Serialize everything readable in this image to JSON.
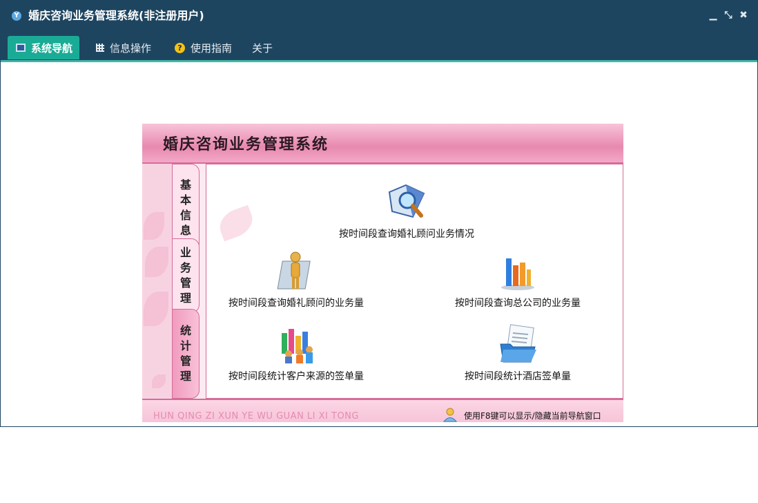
{
  "window": {
    "title": "婚庆咨询业务管理系统(非注册用户)",
    "app_icon": "app-logo-icon",
    "controls": [
      "minimize-icon",
      "restore-icon",
      "close-icon"
    ]
  },
  "menu": {
    "tabs": [
      {
        "label": "系统导航",
        "icon": "monitor-icon",
        "active": true
      },
      {
        "label": "信息操作",
        "icon": "grid-icon",
        "active": false
      },
      {
        "label": "使用指南",
        "icon": "help-icon",
        "active": false
      },
      {
        "label": "关于",
        "icon": "",
        "active": false
      }
    ]
  },
  "nav": {
    "header_title": "婚庆咨询业务管理系统",
    "side_tabs": [
      {
        "label": "基本信息",
        "active": false
      },
      {
        "label": "业务管理",
        "active": false
      },
      {
        "label": "统计管理",
        "active": true
      }
    ],
    "items": [
      {
        "label": "按时间段查询婚礼顾问业务情况",
        "icon": "book-magnifier-icon"
      },
      {
        "label": "按时间段查询婚礼顾问的业务量",
        "icon": "person-chart-icon"
      },
      {
        "label": "按时间段查询总公司的业务量",
        "icon": "bar-chart-icon"
      },
      {
        "label": "按时间段统计客户来源的签单量",
        "icon": "group-chart-icon"
      },
      {
        "label": "按时间段统计酒店签单量",
        "icon": "folder-document-icon"
      }
    ],
    "footer_brand": "HUN QING ZI XUN YE WU GUAN LI XI TONG",
    "footer_hint": "使用F8键可以显示/隐藏当前导航窗口"
  },
  "colors": {
    "titlebar": "#1e4560",
    "active_tab": "#1aab96",
    "accent_line": "#3fb8a8",
    "nav_pink": "#e889b0"
  }
}
